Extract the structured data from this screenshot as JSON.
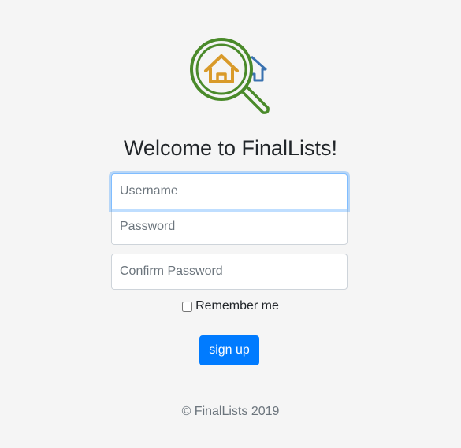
{
  "colors": {
    "background": "#f5f5f5",
    "primary": "#007bff",
    "logo_green": "#4a8a2a",
    "logo_orange": "#d99a2a",
    "logo_blue": "#3a72b0"
  },
  "logo": {
    "icon": "magnifying-glass-house-icon"
  },
  "heading": "Welcome to FinalLists!",
  "form": {
    "username_placeholder": "Username",
    "password_placeholder": "Password",
    "confirm_placeholder": "Confirm Password",
    "remember_label": "Remember me",
    "remember_checked": false,
    "submit_label": "sign up"
  },
  "footer": "© FinalLists 2019"
}
